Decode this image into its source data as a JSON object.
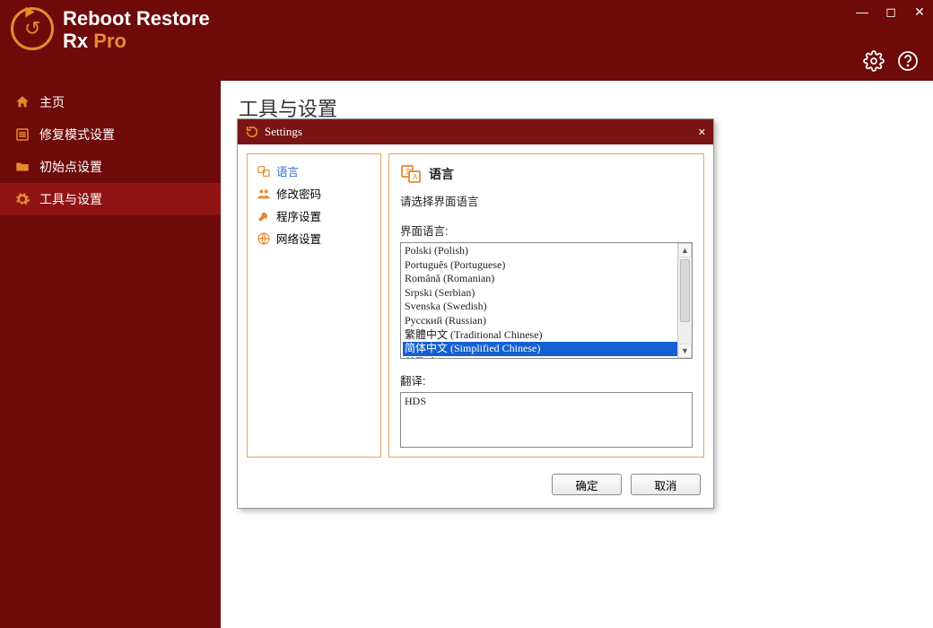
{
  "app_name_line1": "Reboot Restore",
  "app_name_line2a": "Rx ",
  "app_name_line2b": "Pro",
  "sidebar": {
    "items": [
      {
        "label": "主页"
      },
      {
        "label": "修复模式设置"
      },
      {
        "label": "初始点设置"
      },
      {
        "label": "工具与设置"
      }
    ]
  },
  "page_title": "工具与设置",
  "dialog": {
    "title": "Settings",
    "nav": [
      {
        "label": "语言"
      },
      {
        "label": "修改密码"
      },
      {
        "label": "程序设置"
      },
      {
        "label": "网络设置"
      }
    ],
    "heading": "语言",
    "instruction": "请选择界面语言",
    "list_label": "界面语言:",
    "languages": [
      "Polski (Polish)",
      "Português (Portuguese)",
      "Română (Romanian)",
      "Srpski (Serbian)",
      "Svenska (Swedish)",
      "Русский (Russian)",
      "繁體中文 (Traditional Chinese)",
      "简体中文 (Simplified Chinese)",
      "한국어 (Korean)"
    ],
    "selected_index": 7,
    "translator_label": "翻译:",
    "translator_value": "HDS",
    "ok": "确定",
    "cancel": "取消"
  }
}
